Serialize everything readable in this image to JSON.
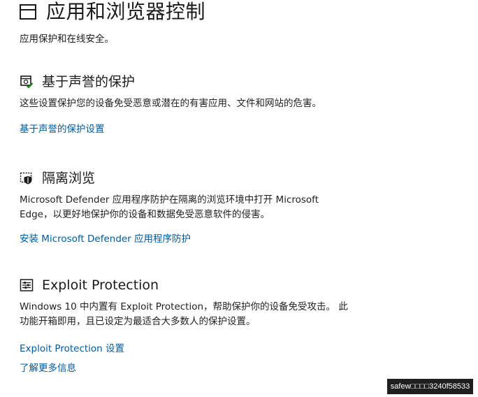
{
  "page": {
    "title": "应用和浏览器控制",
    "subtitle": "应用保护和在线安全。"
  },
  "sections": [
    {
      "icon": "reputation-protection-icon",
      "title": "基于声誉的保护",
      "description": "这些设置保护您的设备免受恶意或潜在的有害应用、文件和网站的危害。",
      "links": [
        "基于声誉的保护设置"
      ]
    },
    {
      "icon": "isolated-browsing-icon",
      "title": "隔离浏览",
      "description": "Microsoft Defender 应用程序防护在隔离的浏览环境中打开 Microsoft Edge，以更好地保护你的设备和数据免受恶意软件的侵害。",
      "links": [
        "安装 Microsoft Defender 应用程序防护"
      ]
    },
    {
      "icon": "exploit-protection-icon",
      "title": "Exploit Protection",
      "description": "Windows 10 中内置有 Exploit Protection，帮助保护你的设备免受攻击。 此功能开箱即用，且已设定为最适合大多数人的保护设置。",
      "links": [
        "Exploit Protection 设置",
        "了解更多信息"
      ]
    }
  ],
  "watermark": "safew□□□□3240f58533",
  "colors": {
    "link": "#005a9e",
    "check": "#107c10",
    "text": "#1a1a1a",
    "background": "#ffffff"
  }
}
